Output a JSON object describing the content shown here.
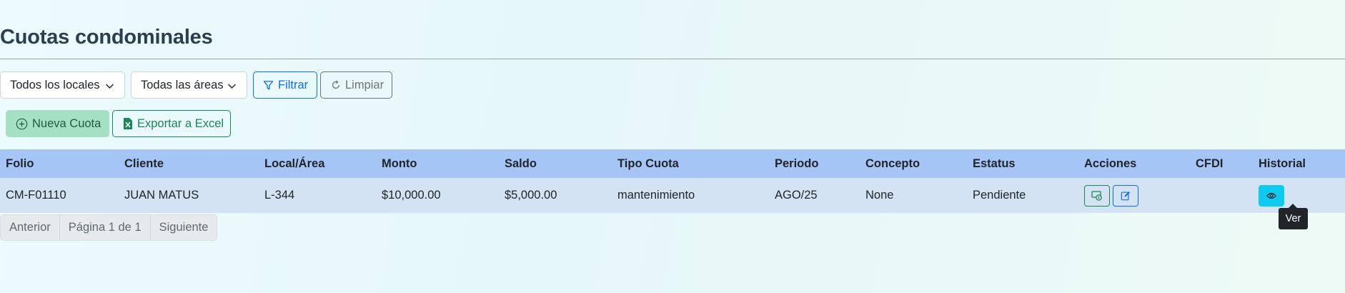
{
  "page": {
    "title": "Cuotas condominales"
  },
  "filters": {
    "locales_select": {
      "value": "Todos los locales",
      "icon": "chevron-down-icon"
    },
    "areas_select": {
      "value": "Todas las áreas",
      "icon": "chevron-down-icon"
    },
    "filter_button": {
      "label": "Filtrar",
      "icon": "filter-icon"
    },
    "clear_button": {
      "label": "Limpiar",
      "icon": "refresh-icon"
    }
  },
  "actions": {
    "new_button": {
      "label": "Nueva Cuota",
      "icon": "plus-circle-icon"
    },
    "export_button": {
      "label": "Exportar a Excel",
      "icon": "excel-file-icon"
    }
  },
  "table": {
    "headers": [
      "Folio",
      "Cliente",
      "Local/Área",
      "Monto",
      "Saldo",
      "Tipo Cuota",
      "Periodo",
      "Concepto",
      "Estatus",
      "Acciones",
      "CFDI",
      "Historial"
    ],
    "rows": [
      {
        "folio": "CM-F01110",
        "cliente": "JUAN MATUS",
        "local": "L-344",
        "monto": "$10,000.00",
        "saldo": "$5,000.00",
        "tipo": "mantenimiento",
        "periodo": "AGO/25",
        "concepto": "None",
        "estatus": "Pendiente",
        "acciones": [
          "cash-payment-icon",
          "edit-icon"
        ],
        "cfdi": "",
        "historial": "eye-icon"
      }
    ]
  },
  "pagination": {
    "prev": "Anterior",
    "page_info": "Página 1 de 1",
    "next": "Siguiente"
  },
  "tooltip": {
    "text": "Ver"
  },
  "colors": {
    "header_bg": "#a6c5f7",
    "row_bg": "#d3e3f3",
    "primary": "#0d6efd",
    "success": "#198754",
    "info": "#0dcaf0"
  }
}
